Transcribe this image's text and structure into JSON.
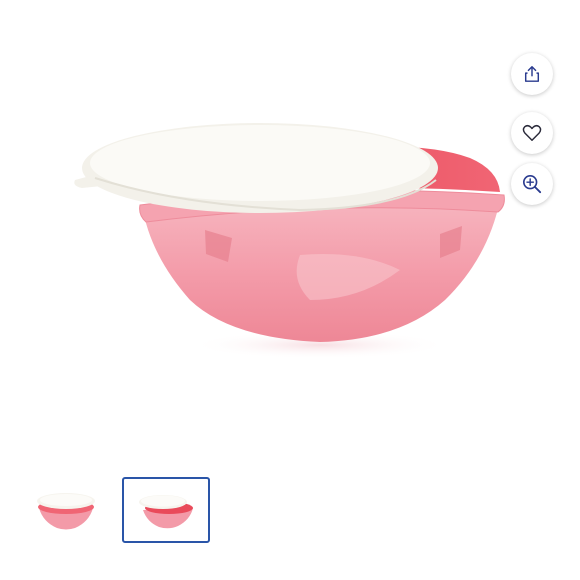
{
  "gallery": {
    "actions": [
      {
        "name": "share",
        "icon": "share-icon"
      },
      {
        "name": "favorite",
        "icon": "heart-icon"
      },
      {
        "name": "zoom",
        "icon": "zoom-in-icon"
      }
    ],
    "thumbnails": [
      {
        "id": 1,
        "selected": false
      },
      {
        "id": 2,
        "selected": true
      }
    ]
  },
  "colors": {
    "bowl": "#f4a4b0",
    "bowl_dark": "#e88895",
    "bowl_inner": "#e94a5a",
    "lid": "#f7f5f0",
    "accent": "#2a55a8",
    "icon": "#2a3b8f"
  }
}
